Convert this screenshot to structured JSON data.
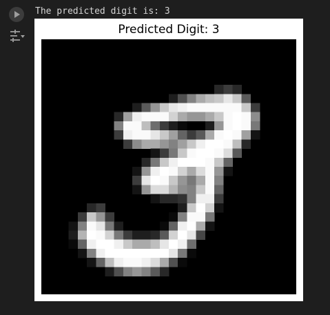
{
  "output": {
    "stdout_text": "The predicted digit is: 3",
    "figure_title": "Predicted Digit: 3"
  },
  "gutter": {
    "run_icon": "play-icon",
    "output_toggle_icon": "output-settings-icon"
  },
  "image": {
    "size": 28,
    "pixels": [
      [
        0,
        0,
        0,
        0,
        0,
        0,
        0,
        0,
        0,
        0,
        0,
        0,
        0,
        0,
        0,
        0,
        0,
        0,
        0,
        0,
        0,
        0,
        0,
        0,
        0,
        0,
        0,
        0
      ],
      [
        0,
        0,
        0,
        0,
        0,
        0,
        0,
        0,
        0,
        0,
        0,
        0,
        0,
        0,
        0,
        0,
        0,
        0,
        0,
        0,
        0,
        0,
        0,
        0,
        0,
        0,
        0,
        0
      ],
      [
        0,
        0,
        0,
        0,
        0,
        0,
        0,
        0,
        0,
        0,
        0,
        0,
        0,
        0,
        0,
        0,
        0,
        0,
        0,
        0,
        0,
        0,
        0,
        0,
        0,
        0,
        0,
        0
      ],
      [
        0,
        0,
        0,
        0,
        0,
        0,
        0,
        0,
        0,
        0,
        0,
        0,
        0,
        0,
        0,
        0,
        0,
        0,
        0,
        0,
        0,
        0,
        0,
        0,
        0,
        0,
        0,
        0
      ],
      [
        0,
        0,
        0,
        0,
        0,
        0,
        0,
        0,
        0,
        0,
        0,
        0,
        0,
        0,
        0,
        0,
        0,
        0,
        0,
        0,
        0,
        0,
        0,
        0,
        0,
        0,
        0,
        0
      ],
      [
        0,
        0,
        0,
        0,
        0,
        0,
        0,
        0,
        0,
        0,
        0,
        0,
        0,
        0,
        0,
        0,
        0,
        0,
        0,
        40,
        60,
        40,
        0,
        0,
        0,
        0,
        0,
        0
      ],
      [
        0,
        0,
        0,
        0,
        0,
        0,
        0,
        0,
        0,
        0,
        0,
        0,
        0,
        0,
        30,
        80,
        130,
        170,
        190,
        200,
        230,
        200,
        90,
        0,
        0,
        0,
        0,
        0
      ],
      [
        0,
        0,
        0,
        0,
        0,
        0,
        0,
        0,
        0,
        0,
        30,
        90,
        150,
        200,
        230,
        240,
        250,
        250,
        250,
        250,
        250,
        250,
        200,
        60,
        0,
        0,
        0,
        0
      ],
      [
        0,
        0,
        0,
        0,
        0,
        0,
        0,
        0,
        40,
        160,
        240,
        250,
        250,
        250,
        210,
        170,
        150,
        150,
        170,
        200,
        250,
        255,
        250,
        140,
        0,
        0,
        0,
        0
      ],
      [
        0,
        0,
        0,
        0,
        0,
        0,
        0,
        0,
        130,
        250,
        250,
        190,
        110,
        60,
        30,
        10,
        0,
        0,
        30,
        150,
        250,
        255,
        250,
        120,
        0,
        0,
        0,
        0
      ],
      [
        0,
        0,
        0,
        0,
        0,
        0,
        0,
        0,
        60,
        240,
        250,
        250,
        230,
        200,
        160,
        100,
        60,
        90,
        170,
        250,
        255,
        250,
        160,
        20,
        0,
        0,
        0,
        0
      ],
      [
        0,
        0,
        0,
        0,
        0,
        0,
        0,
        0,
        0,
        60,
        140,
        170,
        170,
        150,
        130,
        160,
        200,
        240,
        255,
        255,
        250,
        190,
        40,
        0,
        0,
        0,
        0,
        0
      ],
      [
        0,
        0,
        0,
        0,
        0,
        0,
        0,
        0,
        0,
        0,
        0,
        0,
        20,
        60,
        120,
        200,
        250,
        255,
        255,
        250,
        220,
        90,
        0,
        0,
        0,
        0,
        0,
        0
      ],
      [
        0,
        0,
        0,
        0,
        0,
        0,
        0,
        0,
        0,
        0,
        0,
        40,
        120,
        200,
        240,
        255,
        255,
        255,
        250,
        200,
        100,
        0,
        0,
        0,
        0,
        0,
        0,
        0
      ],
      [
        0,
        0,
        0,
        0,
        0,
        0,
        0,
        0,
        0,
        0,
        20,
        150,
        240,
        255,
        250,
        210,
        170,
        220,
        250,
        150,
        20,
        0,
        0,
        0,
        0,
        0,
        0,
        0
      ],
      [
        0,
        0,
        0,
        0,
        0,
        0,
        0,
        0,
        0,
        0,
        60,
        230,
        255,
        250,
        200,
        150,
        120,
        170,
        250,
        130,
        0,
        0,
        0,
        0,
        0,
        0,
        0,
        0
      ],
      [
        0,
        0,
        0,
        0,
        0,
        0,
        0,
        0,
        0,
        0,
        20,
        150,
        220,
        220,
        180,
        140,
        130,
        200,
        250,
        100,
        0,
        0,
        0,
        0,
        0,
        0,
        0,
        0
      ],
      [
        0,
        0,
        0,
        0,
        0,
        0,
        0,
        0,
        0,
        0,
        0,
        0,
        20,
        40,
        40,
        50,
        130,
        240,
        240,
        60,
        0,
        0,
        0,
        0,
        0,
        0,
        0,
        0
      ],
      [
        0,
        0,
        0,
        0,
        0,
        40,
        60,
        0,
        0,
        0,
        0,
        0,
        0,
        0,
        0,
        30,
        200,
        255,
        210,
        20,
        0,
        0,
        0,
        0,
        0,
        0,
        0,
        0
      ],
      [
        0,
        0,
        0,
        0,
        60,
        200,
        150,
        60,
        0,
        0,
        0,
        0,
        0,
        0,
        10,
        130,
        250,
        250,
        120,
        0,
        0,
        0,
        0,
        0,
        0,
        0,
        0,
        0
      ],
      [
        0,
        0,
        0,
        20,
        130,
        250,
        230,
        120,
        30,
        0,
        0,
        0,
        0,
        10,
        100,
        240,
        255,
        170,
        20,
        0,
        0,
        0,
        0,
        0,
        0,
        0,
        0,
        0
      ],
      [
        0,
        0,
        0,
        30,
        180,
        255,
        250,
        210,
        120,
        60,
        30,
        30,
        40,
        90,
        210,
        255,
        230,
        70,
        0,
        0,
        0,
        0,
        0,
        0,
        0,
        0,
        0,
        0
      ],
      [
        0,
        0,
        0,
        10,
        100,
        240,
        255,
        255,
        240,
        200,
        170,
        170,
        190,
        230,
        255,
        240,
        110,
        0,
        0,
        0,
        0,
        0,
        0,
        0,
        0,
        0,
        0,
        0
      ],
      [
        0,
        0,
        0,
        0,
        20,
        130,
        240,
        255,
        255,
        255,
        255,
        255,
        255,
        255,
        230,
        120,
        10,
        0,
        0,
        0,
        0,
        0,
        0,
        0,
        0,
        0,
        0,
        0
      ],
      [
        0,
        0,
        0,
        0,
        0,
        20,
        100,
        190,
        240,
        250,
        250,
        240,
        220,
        170,
        80,
        10,
        0,
        0,
        0,
        0,
        0,
        0,
        0,
        0,
        0,
        0,
        0,
        0
      ],
      [
        0,
        0,
        0,
        0,
        0,
        0,
        0,
        30,
        80,
        130,
        150,
        130,
        90,
        40,
        0,
        0,
        0,
        0,
        0,
        0,
        0,
        0,
        0,
        0,
        0,
        0,
        0,
        0
      ],
      [
        0,
        0,
        0,
        0,
        0,
        0,
        0,
        0,
        0,
        0,
        0,
        0,
        0,
        0,
        0,
        0,
        0,
        0,
        0,
        0,
        0,
        0,
        0,
        0,
        0,
        0,
        0,
        0
      ],
      [
        0,
        0,
        0,
        0,
        0,
        0,
        0,
        0,
        0,
        0,
        0,
        0,
        0,
        0,
        0,
        0,
        0,
        0,
        0,
        0,
        0,
        0,
        0,
        0,
        0,
        0,
        0,
        0
      ]
    ]
  }
}
